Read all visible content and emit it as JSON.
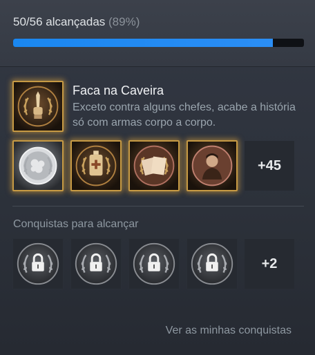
{
  "progress": {
    "summary": "50/56 alcançadas",
    "percent_label": "(89%)",
    "fraction": 0.892
  },
  "featured": {
    "title": "Faca na Caveira",
    "description": "Exceto contra alguns chefes, acabe a história só com armas corpo a corpo.",
    "icon": "knife-fist-emblem"
  },
  "unlocked_row": {
    "icons": [
      "silver-coin-emblem",
      "medicine-bottle-emblem",
      "documents-emblem",
      "portrait-emblem"
    ],
    "more_label": "+45"
  },
  "locked_section": {
    "label": "Conquistas para alcançar",
    "icons": [
      "padlock-icon",
      "padlock-icon",
      "padlock-icon",
      "padlock-icon"
    ],
    "more_label": "+2"
  },
  "footer": {
    "link_label": "Ver as minhas conquistas"
  },
  "colors": {
    "accent": "#1a87f0",
    "gold_glow": "#c79a44"
  }
}
